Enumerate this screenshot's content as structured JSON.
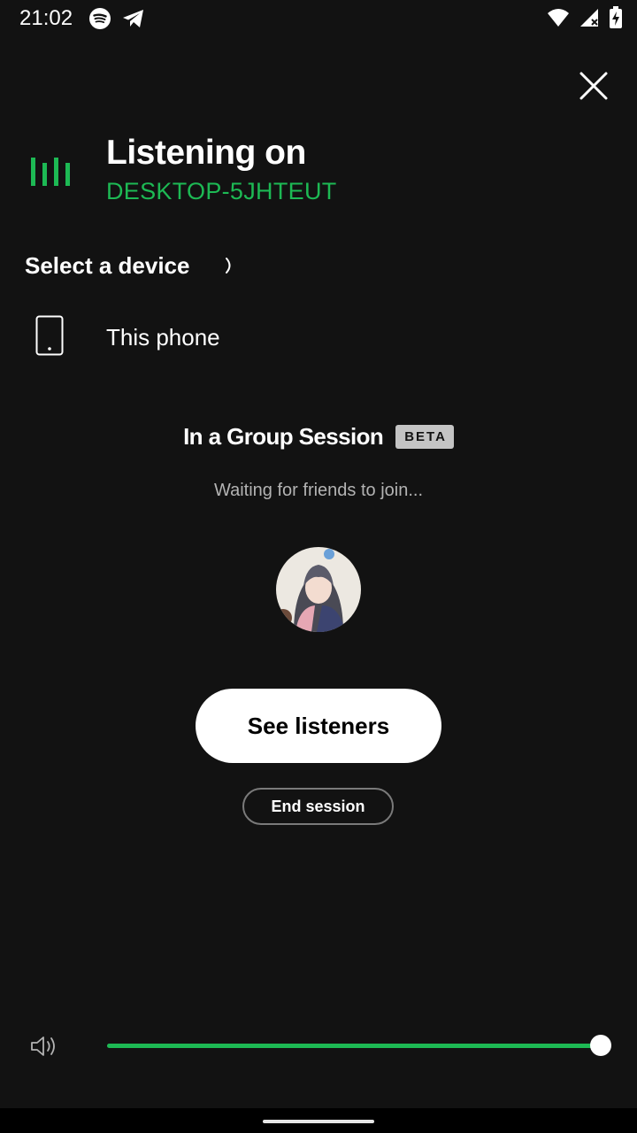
{
  "status_bar": {
    "time": "21:02",
    "left_icons": [
      "spotify-icon",
      "telegram-icon"
    ],
    "right_icons": [
      "wifi-icon",
      "signal-icon",
      "battery-charging-icon"
    ]
  },
  "header": {
    "close_icon": "close-icon"
  },
  "listening": {
    "title": "Listening on",
    "device": "DESKTOP-5JHTEUT",
    "icon": "speaker-bars-icon"
  },
  "devices": {
    "label": "Select a device",
    "items": [
      {
        "label": "This phone",
        "icon": "phone-icon"
      }
    ]
  },
  "group_session": {
    "title": "In a Group Session",
    "badge": "BETA",
    "waiting": "Waiting for friends to join...",
    "see_listeners": "See listeners",
    "end_session": "End session"
  },
  "volume": {
    "level": 0.99,
    "icon": "volume-icon"
  },
  "colors": {
    "background": "#121212",
    "accent": "#1db954",
    "text": "#ffffff",
    "secondary_text": "#b3b3b3"
  }
}
